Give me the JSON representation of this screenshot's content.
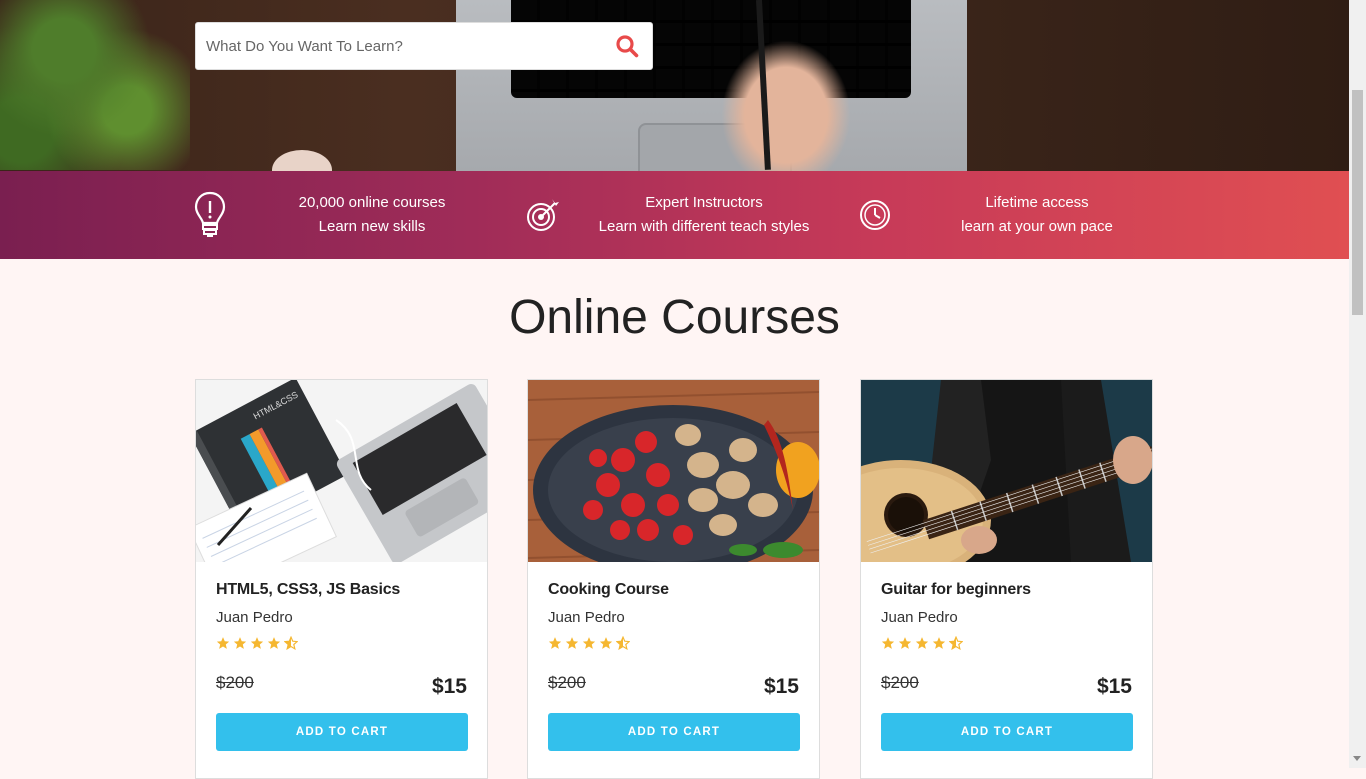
{
  "search": {
    "placeholder": "What Do You Want To Learn?",
    "icon": "search-icon",
    "icon_color": "#e84a4a"
  },
  "features": [
    {
      "icon": "lightbulb-icon",
      "line1": "20,000 online courses",
      "line2": "Learn new skills"
    },
    {
      "icon": "target-icon",
      "line1": "Expert Instructors",
      "line2": "Learn with different teach styles"
    },
    {
      "icon": "clock-icon",
      "line1": "Lifetime access",
      "line2": "learn at your own pace"
    }
  ],
  "section": {
    "title": "Online Courses"
  },
  "courses": [
    {
      "title": "HTML5, CSS3, JS Basics",
      "author": "Juan Pedro",
      "rating": 4.5,
      "old_price": "$200",
      "price": "$15",
      "button": "ADD TO CART"
    },
    {
      "title": "Cooking Course",
      "author": "Juan Pedro",
      "rating": 4.5,
      "old_price": "$200",
      "price": "$15",
      "button": "ADD TO CART"
    },
    {
      "title": "Guitar for beginners",
      "author": "Juan Pedro",
      "rating": 4.5,
      "old_price": "$200",
      "price": "$15",
      "button": "ADD TO CART"
    }
  ],
  "colors": {
    "strip_start": "#7a1f50",
    "strip_end": "#e04f52",
    "button": "#33c0ec",
    "star": "#f5b731",
    "page_bg": "#fff5f4"
  }
}
